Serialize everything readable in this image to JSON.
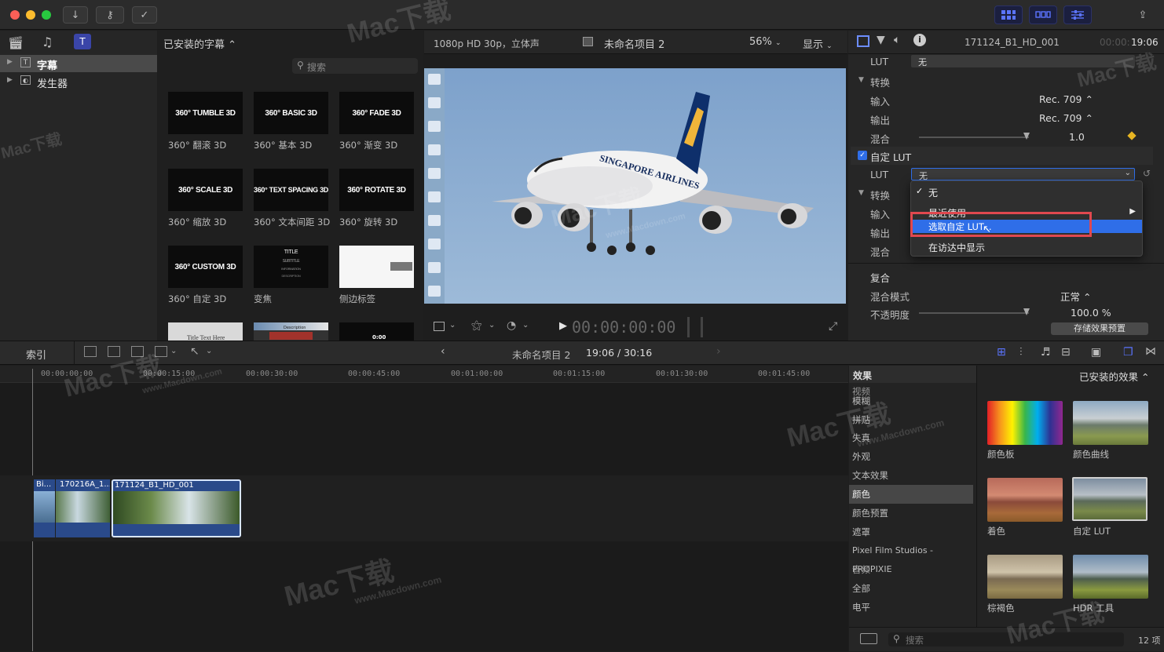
{
  "browser": {
    "sidebar_items": [
      {
        "label": "字幕",
        "selected": true
      },
      {
        "label": "发生器",
        "selected": false
      }
    ],
    "dropdown_label": "已安装的字幕 ⌃",
    "search_placeholder": "搜索",
    "tiles": [
      {
        "thumb": "360° TUMBLE 3D",
        "caption": "360° 翻滚 3D"
      },
      {
        "thumb": "360° BASIC 3D",
        "caption": "360° 基本 3D"
      },
      {
        "thumb": "360° FADE 3D",
        "caption": "360° 渐变 3D"
      },
      {
        "thumb": "360° SCALE 3D",
        "caption": "360° 缩放 3D"
      },
      {
        "thumb": "360° TEXT SPACING 3D",
        "caption": "360° 文本间距 3D"
      },
      {
        "thumb": "360° ROTATE 3D",
        "caption": "360° 旋转 3D"
      },
      {
        "thumb": "360° CUSTOM 3D",
        "caption": "360° 自定 3D"
      },
      {
        "thumb": "TITLE",
        "caption": "变焦"
      },
      {
        "thumb": "",
        "caption": "侧边标签"
      }
    ],
    "focus_thumb_lines": [
      "SUBTITLE",
      "INFORMATION",
      "DESCRIPTION"
    ],
    "partial_tiles": [
      "Title Text Here",
      "Description",
      "0:00"
    ]
  },
  "viewer": {
    "format": "1080p HD 30p，立体声",
    "project": "未命名项目 2",
    "zoom": "56%",
    "display": "显示",
    "timecode": "00:00:00:00",
    "plane_livery": "SINGAPORE AIRLINES"
  },
  "inspector": {
    "clip_name": "171124_B1_HD_001",
    "clip_time_dim": "00:00:",
    "clip_time": "19:06",
    "lut_label": "LUT",
    "lut_value": "无",
    "convert_label": "转换",
    "input_label": "输入",
    "input_value": "Rec. 709 ⌃",
    "output_label": "输出",
    "output_value": "Rec. 709 ⌃",
    "mix_label": "混合",
    "mix_value": "1.0",
    "custom_lut_label": "自定 LUT",
    "lut2_label": "LUT",
    "lut2_value": "无",
    "convert2_label": "转换",
    "input2_label": "输入",
    "output2_label": "输出",
    "mix2_label": "混合",
    "composite_label": "复合",
    "blend_mode_label": "混合模式",
    "blend_mode_value": "正常 ⌃",
    "opacity_label": "不透明度",
    "opacity_value": "100.0 %",
    "save_preset": "存储效果预置"
  },
  "dropdown_menu": {
    "items": [
      {
        "label": "无",
        "checked": true
      },
      {
        "label": "最近使用",
        "submenu": true
      },
      {
        "label": "选取自定 LUT...",
        "highlighted": true
      },
      {
        "label": "在访达中显示"
      }
    ]
  },
  "timeline": {
    "index_label": "索引",
    "project": "未命名项目 2",
    "duration": "19:06 / 30:16",
    "ruler": [
      "00:00:00:00",
      "00:00:15:00",
      "00:00:30:00",
      "00:00:45:00",
      "00:01:00:00",
      "00:01:15:00",
      "00:01:30:00",
      "00:01:45:00"
    ],
    "clips": [
      {
        "label": "Bi..."
      },
      {
        "label": "170216A_1..."
      },
      {
        "label": "171124_B1_HD_001"
      }
    ]
  },
  "effects": {
    "title": "效果",
    "installed": "已安装的效果 ⌃",
    "categories": [
      {
        "label": "视频",
        "header": true
      },
      {
        "label": "模糊"
      },
      {
        "label": "拼贴"
      },
      {
        "label": "失真"
      },
      {
        "label": "外观"
      },
      {
        "label": "文本效果"
      },
      {
        "label": "颜色",
        "selected": true
      },
      {
        "label": "颜色预置"
      },
      {
        "label": "遮罩"
      },
      {
        "label": "Pixel Film Studios - PROPIXIE"
      },
      {
        "label": "音频",
        "header": true
      },
      {
        "label": "全部"
      },
      {
        "label": "电平"
      }
    ],
    "items": [
      {
        "label": "颜色板"
      },
      {
        "label": "颜色曲线"
      },
      {
        "label": "着色"
      },
      {
        "label": "自定 LUT"
      },
      {
        "label": "棕褐色"
      },
      {
        "label": "HDR 工具"
      }
    ],
    "search_placeholder": "搜索",
    "count": "12 项"
  },
  "watermark": {
    "brand": "Mac下载",
    "url": "www.Macdown.com"
  },
  "colors": {
    "accent": "#2f6ee8",
    "highlight_box": "#e0484f",
    "keyframe": "#e6b422",
    "selected_clip_border": "#d8e6ff"
  }
}
